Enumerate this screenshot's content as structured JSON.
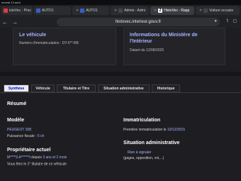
{
  "status_bar": {
    "datetime": "ercredi 13 août"
  },
  "browser_tabs": [
    {
      "label": "istoVec - Proc",
      "favicon": "red"
    },
    {
      "label": "AUTO1",
      "favicon": "blue"
    },
    {
      "label": "AUTO1",
      "favicon": "blue"
    },
    {
      "label": "Admin - Admi",
      "favicon": "dark"
    },
    {
      "label": "HistoVec - Rapp",
      "favicon": "histo",
      "active": true
    },
    {
      "label": "Voiture occasio",
      "favicon": "dark"
    }
  ],
  "address_bar": {
    "url": "histovec.interieur.gouv.fr"
  },
  "cards": {
    "vehicle": {
      "title": "Le véhicule",
      "registration": "Numéro d'immatriculation : DY-5**-BB"
    },
    "ministry": {
      "title_line1": "Informations du Ministère de",
      "title_line2": "l'Intérieur",
      "date": "Datant du 12/08/2025"
    }
  },
  "page_tabs": [
    "Synthèse",
    "Véhicule",
    "Titulaire et Titre",
    "Situation administrative",
    "Historique"
  ],
  "summary": {
    "heading": "Résumé",
    "model": {
      "heading": "Modèle",
      "name": "PEUGEOT 208",
      "power_label": "Puissance fiscale : ",
      "power_value": "5 ch"
    },
    "owner": {
      "heading": "Propriétaire actuel",
      "name": "M****S A******t",
      "since_prefix": " depuis ",
      "since_value": "3 ans et 2 mois",
      "rank_prefix": "Vous êtes le ",
      "rank_value": "3",
      "rank_suffix": "e",
      "rank_rest": " titulaire de ce véhicule"
    },
    "registration": {
      "heading": "Immatriculation",
      "label": "Première immatriculation le ",
      "date": "10/12/2015"
    },
    "admin": {
      "heading": "Situation administrative",
      "status": "Rien à signaler",
      "detail": "(gages, opposition, vol,...)"
    }
  }
}
